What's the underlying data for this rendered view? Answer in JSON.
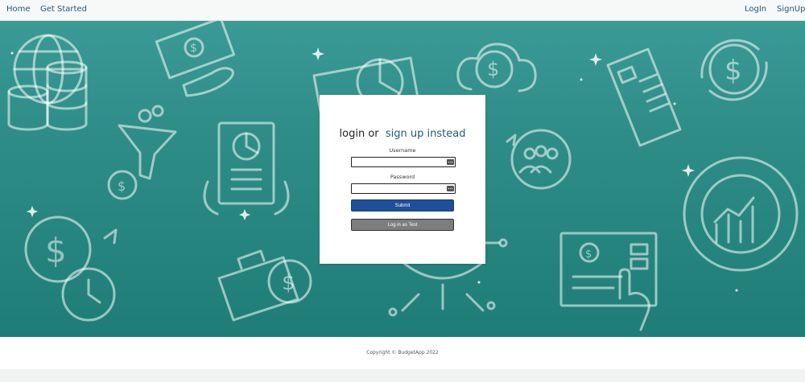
{
  "nav": {
    "home": "Home",
    "get_started": "Get Started",
    "login": "LogIn",
    "signup": "SignUp"
  },
  "login_card": {
    "heading_prefix": "login or",
    "heading_link": "sign up instead",
    "username_label": "Username",
    "username_value": "",
    "password_label": "Password",
    "password_value": "",
    "submit_label": "Submit",
    "test_login_label": "Log in as Test"
  },
  "footer": {
    "copyright": "Copyright © BudgetApp 2022"
  },
  "colors": {
    "hero_top": "#3a9a95",
    "hero_bottom": "#1f7d77",
    "link": "#1f5a78",
    "submit_button": "#1f4f9a",
    "test_button": "#7d7d7d"
  },
  "icons": [
    "globe-coins-icon",
    "money-hand-icon",
    "report-screen-icon",
    "cloud-dollar-icon",
    "sparkle-icon",
    "receipt-icon",
    "dollar-cycle-icon",
    "funnel-icon",
    "dollar-coin-icon",
    "phone-chart-icon",
    "team-icon",
    "donut-chart-icon",
    "dollar-clock-icon",
    "briefcase-icon",
    "dollar-tree-icon",
    "invoice-hand-icon"
  ]
}
